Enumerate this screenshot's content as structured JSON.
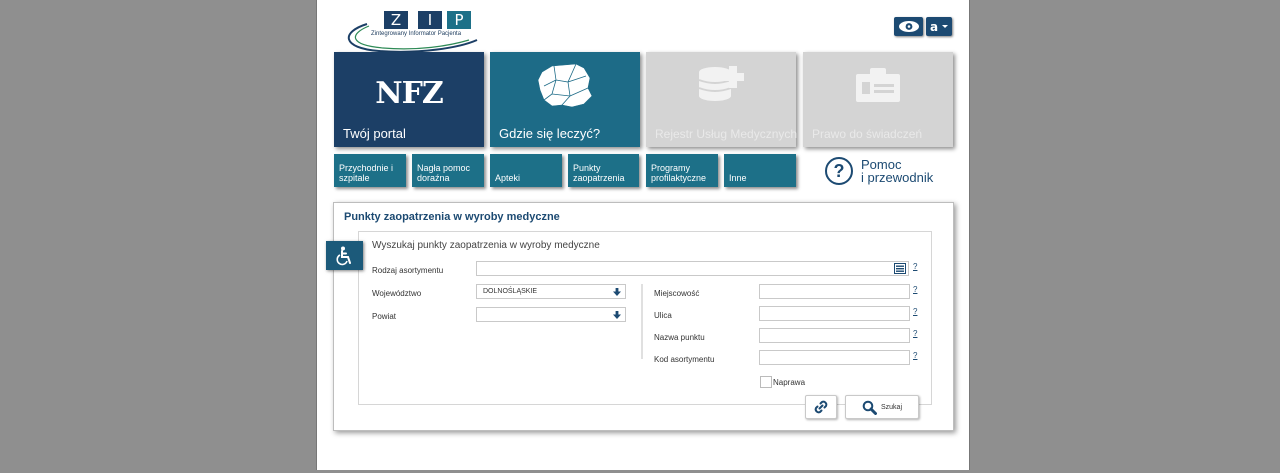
{
  "logo": {
    "letters": [
      "Z",
      "I",
      "P"
    ],
    "tagline": "Zintegrowany Informator Pacjenta"
  },
  "header": {
    "eye_icon": "eye-icon",
    "accessibility_icon": "accessibility-menu-icon"
  },
  "tiles": [
    {
      "label": "Twój portal",
      "logo_text": "NFZ",
      "color": "#1c3f66"
    },
    {
      "label": "Gdzie się leczyć?",
      "icon": "poland-map-icon",
      "color": "#1d6b87"
    },
    {
      "label": "Rejestr Usług Medycznych",
      "icon": "database-plus-icon",
      "color": "#d4d4d4"
    },
    {
      "label": "Prawo do świadczeń",
      "icon": "id-card-icon",
      "color": "#d4d4d4"
    }
  ],
  "categories": [
    {
      "label": "Przychodnie i szpitale"
    },
    {
      "label": "Nagła pomoc doraźna"
    },
    {
      "label": "Apteki"
    },
    {
      "label": "Punkty zaopatrzenia"
    },
    {
      "label": "Programy profilaktyczne"
    },
    {
      "label": "Inne"
    }
  ],
  "help": {
    "line1": "Pomoc",
    "line2": "i przewodnik"
  },
  "panel": {
    "title": "Punkty zaopatrzenia w wyroby medyczne",
    "subtitle": "Wyszukaj punkty zaopatrzenia w wyroby medyczne",
    "fields": {
      "rodzaj": {
        "label": "Rodzaj asortymentu",
        "value": ""
      },
      "wojewodztwo": {
        "label": "Województwo",
        "value": "DOLNOŚLĄSKIE"
      },
      "powiat": {
        "label": "Powiat",
        "value": ""
      },
      "miejscowosc": {
        "label": "Miejscowość",
        "value": ""
      },
      "ulica": {
        "label": "Ulica",
        "value": ""
      },
      "nazwa": {
        "label": "Nazwa punktu",
        "value": ""
      },
      "kod": {
        "label": "Kod asortymentu",
        "value": ""
      }
    },
    "help_mark": "?",
    "naprawa_label": "Naprawa",
    "search_label": "Szukaj"
  }
}
